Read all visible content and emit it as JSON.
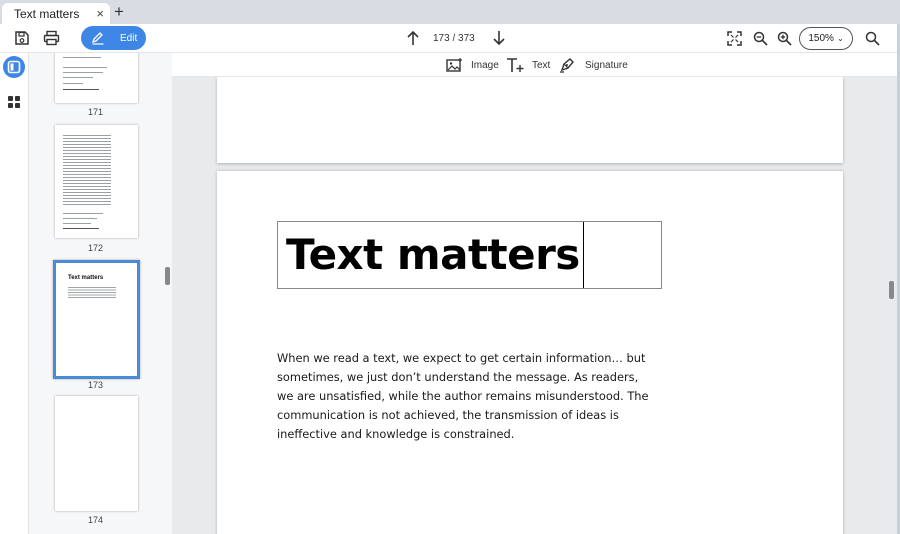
{
  "tab": {
    "title": "Text matters",
    "close_icon": "×",
    "new_tab_icon": "+"
  },
  "toolbar": {
    "edit_label": "Edit",
    "page_counter": "173 / 373",
    "zoom_value": "150%",
    "zoom_chevron": "⌄",
    "accent": "#3d86e5"
  },
  "subtoolbar": {
    "image_label": "Image",
    "text_label": "Text",
    "signature_label": "Signature"
  },
  "thumbnails": [
    {
      "number": "171"
    },
    {
      "number": "172"
    },
    {
      "number": "173",
      "title": "Text matters",
      "selected": true
    },
    {
      "number": "174"
    }
  ],
  "document": {
    "title": "Text matters",
    "paragraph": "When we read a text, we expect to get certain information… but sometimes, we just don’t understand the message. As readers, we are unsatisfied, while the author remains misunderstood. The communication is not achieved, the transmission of ideas is ineffective and knowledge is constrained."
  }
}
